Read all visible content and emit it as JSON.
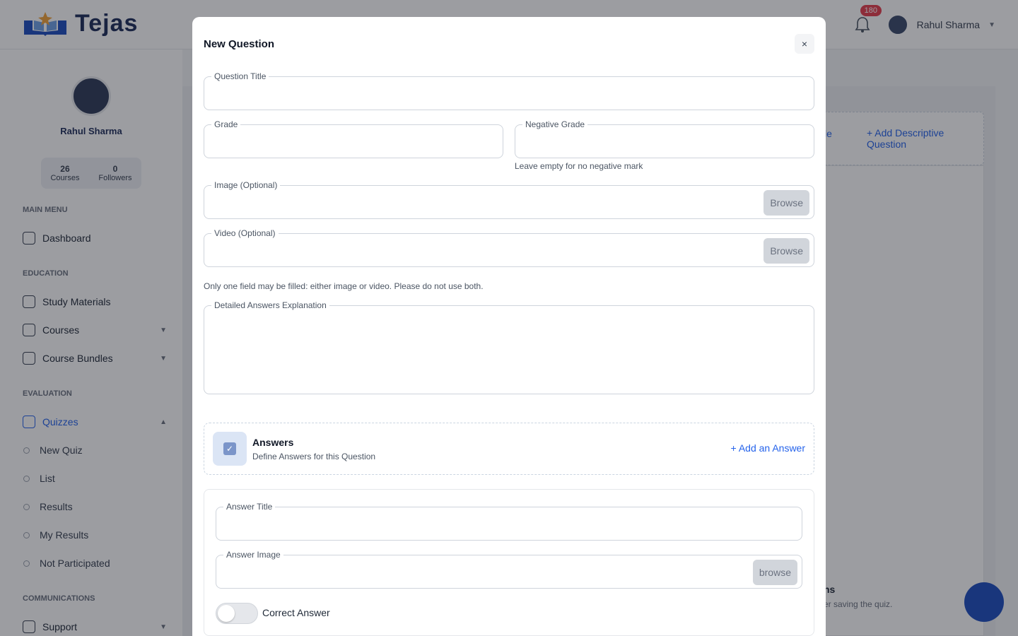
{
  "app": {
    "brand": "Tejas"
  },
  "header": {
    "notification_count": "180",
    "user_name": "Rahul Sharma"
  },
  "sidebar": {
    "profile_name": "Rahul Sharma",
    "stats": [
      {
        "value": "26",
        "label": "Courses"
      },
      {
        "value": "0",
        "label": "Followers"
      }
    ],
    "sections": {
      "main_menu": "MAIN MENU",
      "education": "EDUCATION",
      "evaluation": "EVALUATION",
      "communications": "COMMUNICATIONS"
    },
    "items": {
      "dashboard": "Dashboard",
      "study_materials": "Study Materials",
      "courses": "Courses",
      "course_bundles": "Course Bundles",
      "quizzes": "Quizzes",
      "support": "Support"
    },
    "quiz_subitems": [
      "New Quiz",
      "List",
      "Results",
      "My Results",
      "Not Participated"
    ]
  },
  "background": {
    "partial_link": "le",
    "add_descriptive_question": "+ Add Descriptive Question",
    "partial_heading": "ns",
    "partial_text": "er saving the quiz."
  },
  "modal": {
    "title": "New Question",
    "close_label": "×",
    "fields": {
      "question_title": "Question Title",
      "grade": "Grade",
      "negative_grade": "Negative Grade",
      "negative_grade_hint": "Leave empty for no negative mark",
      "image": "Image (Optional)",
      "video": "Video (Optional)",
      "browse": "Browse",
      "media_hint": "Only one field may be filled: either image or video. Please do not use both.",
      "explanation": "Detailed Answers Explanation"
    },
    "answers": {
      "title": "Answers",
      "subtitle": "Define Answers for this Question",
      "add_label": "+ Add an Answer"
    },
    "answer_form": {
      "answer_title": "Answer Title",
      "answer_image": "Answer Image",
      "browse": "browse",
      "correct_answer": "Correct Answer",
      "correct": false
    }
  }
}
